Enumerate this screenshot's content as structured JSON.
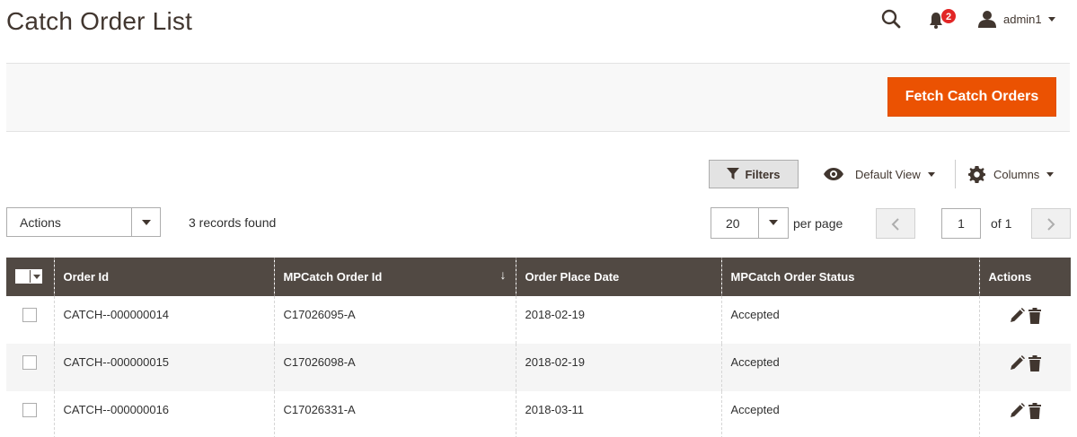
{
  "header": {
    "title": "Catch Order List",
    "notification_count": "2",
    "user_name": "admin1"
  },
  "toolbar": {
    "fetch_label": "Fetch Catch Orders",
    "filters_label": "Filters",
    "view_label": "Default View",
    "columns_label": "Columns"
  },
  "grid_controls": {
    "actions_label": "Actions",
    "records_text": "3 records found",
    "per_page_value": "20",
    "per_page_label": "per page",
    "current_page": "1",
    "page_of": "of 1"
  },
  "table": {
    "columns": [
      "Order Id",
      "MPCatch Order Id",
      "Order Place Date",
      "MPCatch Order Status",
      "Actions"
    ],
    "rows": [
      {
        "order_id": "CATCH--000000014",
        "mp_order_id": "C17026095-A",
        "date": "2018-02-19",
        "status": "Accepted"
      },
      {
        "order_id": "CATCH--000000015",
        "mp_order_id": "C17026098-A",
        "date": "2018-02-19",
        "status": "Accepted"
      },
      {
        "order_id": "CATCH--000000016",
        "mp_order_id": "C17026331-A",
        "date": "2018-03-11",
        "status": "Accepted"
      }
    ]
  },
  "colors": {
    "accent": "#eb5202",
    "header_bg": "#514943",
    "badge": "#e22626"
  },
  "icons": [
    "search-icon",
    "bell-icon",
    "user-icon",
    "filter-icon",
    "eye-icon",
    "gear-icon",
    "chevron-left-icon",
    "chevron-right-icon",
    "edit-icon",
    "delete-icon"
  ]
}
